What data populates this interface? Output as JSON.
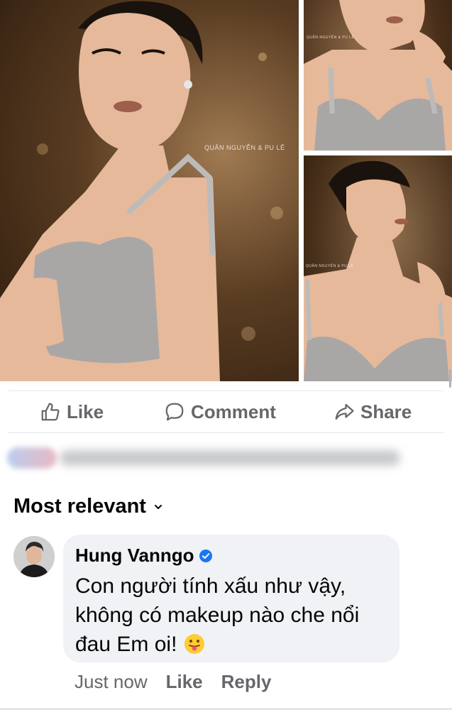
{
  "photos": {
    "watermark_main": "QUÂN NGUYỄN & PU LÊ",
    "watermark_small": "QUÂN NGUYỄN & PU LÊ"
  },
  "actions": {
    "like_label": "Like",
    "comment_label": "Comment",
    "share_label": "Share"
  },
  "comments_section": {
    "sort_label": "Most relevant",
    "comment": {
      "author": "Hung Vanngo",
      "text": "Con người tính xấu như vậy, không có makeup nào che nổi đau Em oi!",
      "timestamp": "Just now",
      "like_label": "Like",
      "reply_label": "Reply"
    }
  },
  "colors": {
    "secondary_text": "#65676b",
    "bubble_bg": "#f0f2f5",
    "verified_blue": "#1877f2"
  },
  "icons": [
    "thumbs-up-icon",
    "comment-icon",
    "share-icon",
    "chevron-down-icon",
    "verified-icon",
    "tongue-emoji-icon"
  ]
}
